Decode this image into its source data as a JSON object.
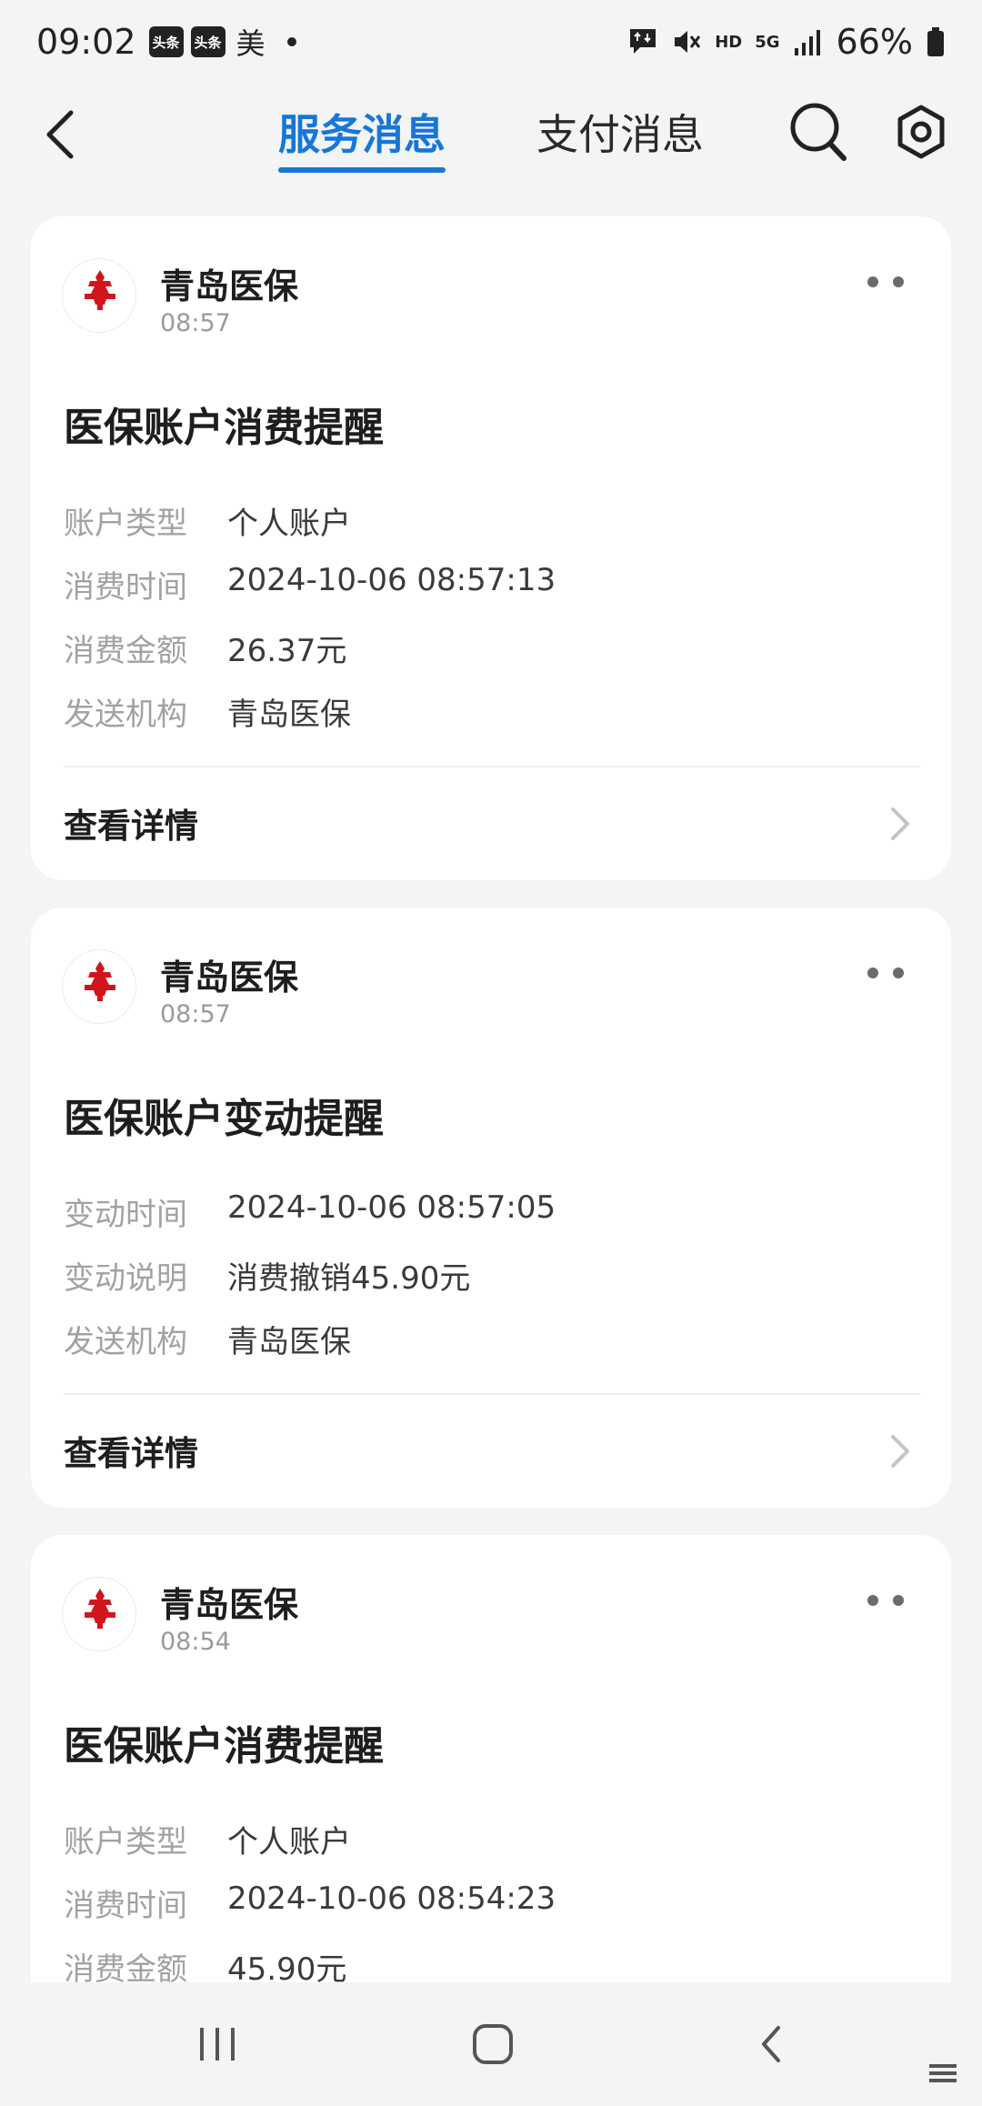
{
  "status_bar": {
    "time": "09:02",
    "badges": [
      "头条",
      "头条"
    ],
    "carrier_char": "美",
    "hd_label": "HD",
    "network_label": "5G",
    "battery": "66%"
  },
  "header": {
    "tabs": [
      {
        "label": "服务消息",
        "active": true
      },
      {
        "label": "支付消息",
        "active": false
      }
    ]
  },
  "cards": [
    {
      "sender": "青岛医保",
      "time": "08:57",
      "title": "医保账户消费提醒",
      "fields": [
        {
          "label": "账户类型",
          "value": "个人账户"
        },
        {
          "label": "消费时间",
          "value": "2024-10-06 08:57:13"
        },
        {
          "label": "消费金额",
          "value": "26.37元"
        },
        {
          "label": "发送机构",
          "value": "青岛医保"
        }
      ],
      "detail_label": "查看详情"
    },
    {
      "sender": "青岛医保",
      "time": "08:57",
      "title": "医保账户变动提醒",
      "fields": [
        {
          "label": "变动时间",
          "value": "2024-10-06 08:57:05"
        },
        {
          "label": "变动说明",
          "value": "消费撤销45.90元"
        },
        {
          "label": "发送机构",
          "value": "青岛医保"
        }
      ],
      "detail_label": "查看详情"
    },
    {
      "sender": "青岛医保",
      "time": "08:54",
      "title": "医保账户消费提醒",
      "fields": [
        {
          "label": "账户类型",
          "value": "个人账户"
        },
        {
          "label": "消费时间",
          "value": "2024-10-06 08:54:23"
        },
        {
          "label": "消费金额",
          "value": "45.90元"
        }
      ]
    }
  ],
  "logo_text": "青岛医保",
  "colors": {
    "accent": "#1677d8",
    "logo_red": "#d0151d",
    "logo_blue": "#1d3f9a",
    "background": "#f3f4f6"
  },
  "icons": {
    "back": "back-arrow-icon",
    "search": "search-icon",
    "settings": "gear-icon",
    "more": "more-dots-icon",
    "chevron": "chevron-right-icon"
  }
}
